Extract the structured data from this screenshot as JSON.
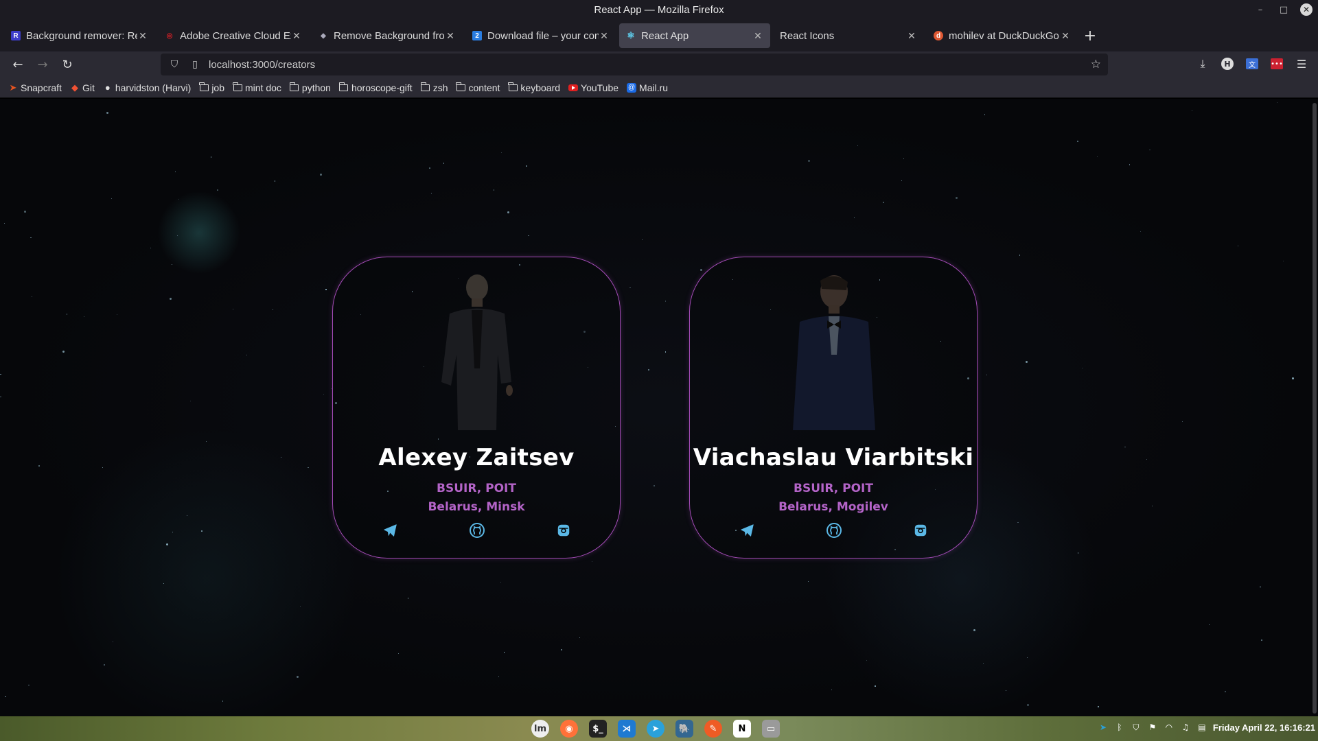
{
  "window": {
    "title": "React App — Mozilla Firefox"
  },
  "tabs": [
    {
      "label": "Background remover: Re",
      "icon": "r-logo-icon",
      "color": "#3d3dc9",
      "active": false
    },
    {
      "label": "Adobe Creative Cloud Ex",
      "icon": "adobe-cc-icon",
      "color": "#da1f26",
      "active": false
    },
    {
      "label": "Remove Background fron",
      "icon": "layers-icon",
      "color": "#8899aa",
      "active": false
    },
    {
      "label": "Download file – your con",
      "icon": "document-icon",
      "color": "#2a7de1",
      "active": false
    },
    {
      "label": "React App",
      "icon": "react-icon",
      "color": "#61dafb",
      "active": true
    },
    {
      "label": "React Icons",
      "icon": "",
      "color": "",
      "active": false
    },
    {
      "label": "mohilev at DuckDuckGo",
      "icon": "duckduckgo-icon",
      "color": "#de5833",
      "active": false
    }
  ],
  "nav": {
    "url": "localhost:3000/creators"
  },
  "bookmarks": [
    {
      "label": "Snapcraft",
      "icon": "snapcraft-icon"
    },
    {
      "label": "Git",
      "icon": "git-icon"
    },
    {
      "label": "harvidston (Harvi)",
      "icon": "github-icon"
    },
    {
      "label": "job",
      "icon": "folder-icon"
    },
    {
      "label": "mint doc",
      "icon": "folder-icon"
    },
    {
      "label": "python",
      "icon": "folder-icon"
    },
    {
      "label": "horoscope-gift",
      "icon": "folder-icon"
    },
    {
      "label": "zsh",
      "icon": "folder-icon"
    },
    {
      "label": "content",
      "icon": "folder-icon"
    },
    {
      "label": "keyboard",
      "icon": "folder-icon"
    },
    {
      "label": "YouTube",
      "icon": "youtube-icon"
    },
    {
      "label": "Mail.ru",
      "icon": "mailru-icon"
    }
  ],
  "creators": [
    {
      "name": "Alexey Zaitsev",
      "university": "BSUIR, POIT",
      "location": "Belarus, Minsk"
    },
    {
      "name": "Viachaslau Viarbitski",
      "university": "BSUIR, POIT",
      "location": "Belarus, Mogilev"
    }
  ],
  "colors": {
    "accent": "#b464c8",
    "card_border": "#a34bb6",
    "social_icon": "#5bb8e6"
  },
  "taskbar": {
    "apps": [
      "linux-mint-menu-icon",
      "firefox-icon",
      "terminal-icon",
      "vscode-icon",
      "telegram-icon",
      "postgres-icon",
      "postman-icon",
      "notion-icon",
      "files-icon"
    ],
    "clock": "Friday April 22, 16:16:21"
  }
}
